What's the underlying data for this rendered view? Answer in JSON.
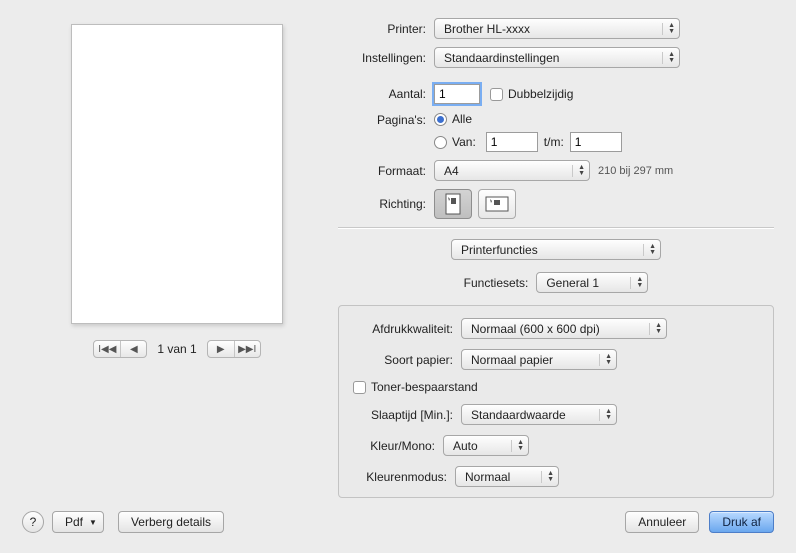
{
  "labels": {
    "printer": "Printer:",
    "presets": "Instellingen:",
    "copies": "Aantal:",
    "duplex": "Dubbelzijdig",
    "pages": "Pagina's:",
    "all": "Alle",
    "from": "Van:",
    "to": "t/m:",
    "paper_size": "Formaat:",
    "orientation": "Richting:",
    "section_select": "Printerfuncties",
    "feature_sets": "Functiesets:",
    "print_quality": "Afdrukkwaliteit:",
    "media_type": "Soort papier:",
    "toner_save": "Toner-bespaarstand",
    "sleep_time": "Slaaptijd [Min.]:",
    "color_mono": "Kleur/Mono:",
    "color_mode": "Kleurenmodus:",
    "pdf": "Pdf",
    "hide_details": "Verberg details",
    "cancel": "Annuleer",
    "print": "Druk af",
    "pager": "1 van 1",
    "help": "?"
  },
  "values": {
    "printer": "Brother HL-xxxx",
    "presets": "Standaardinstellingen",
    "copies": "1",
    "from": "1",
    "to": "1",
    "paper_size": "A4",
    "paper_dim": "210 bij 297 mm",
    "feature_sets": "General 1",
    "print_quality": "Normaal (600 x 600 dpi)",
    "media_type": "Normaal papier",
    "sleep_time": "Standaardwaarde",
    "color_mono": "Auto",
    "color_mode": "Normaal"
  }
}
